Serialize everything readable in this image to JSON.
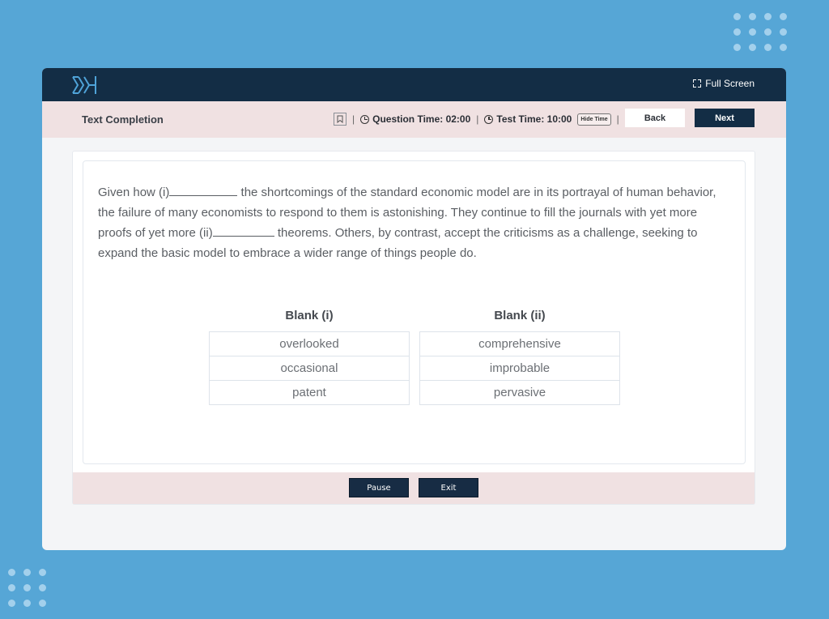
{
  "colors": {
    "background": "#56a6d6",
    "topbar": "#132d45",
    "subbar": "#f0e1e2",
    "primary_button": "#132d45",
    "logo_accent": "#4fa3d8"
  },
  "header": {
    "logo_icon": "chevron-arrows-logo",
    "fullscreen_label": "Full Screen",
    "fullscreen_icon": "expand-icon"
  },
  "toolbar": {
    "section_title": "Text Completion",
    "bookmark_icon": "bookmark-icon",
    "question_time_label": "Question Time: 02:00",
    "test_time_label": "Test Time: 10:00",
    "hide_time_label": "Hide Time",
    "separator": "|",
    "back_label": "Back",
    "next_label": "Next"
  },
  "question": {
    "passage_parts": [
      "Given how (i)",
      " the shortcomings of the standard economic model are in its portrayal of human behavior, the failure of many economists to respond to them is astonishing. They continue to fill the journals with yet more proofs of yet more (ii)",
      " theorems. Others, by contrast, accept the criticisms as a challenge, seeking to expand the basic model to embrace a wider range of things people do."
    ],
    "blanks": [
      {
        "heading": "Blank (i)",
        "options": [
          "overlooked",
          "occasional",
          "patent"
        ]
      },
      {
        "heading": "Blank (ii)",
        "options": [
          "comprehensive",
          "improbable",
          "pervasive"
        ]
      }
    ]
  },
  "footer": {
    "pause_label": "Pause",
    "exit_label": "Exit"
  }
}
